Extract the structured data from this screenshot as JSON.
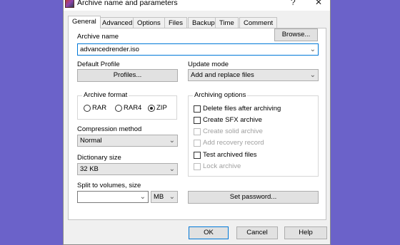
{
  "window": {
    "title": "Archive name and parameters",
    "help_glyph": "?",
    "close_glyph": "✕"
  },
  "tabs": [
    "General",
    "Advanced",
    "Options",
    "Files",
    "Backup",
    "Time",
    "Comment"
  ],
  "archive_name": {
    "label": "Archive name",
    "value": "advancedrender.iso",
    "browse_label": "Browse..."
  },
  "default_profile": {
    "label": "Default Profile",
    "button_label": "Profiles..."
  },
  "update_mode": {
    "label": "Update mode",
    "value": "Add and replace files"
  },
  "archive_format": {
    "title": "Archive format",
    "options": [
      "RAR",
      "RAR4",
      "ZIP"
    ],
    "selected": "ZIP"
  },
  "compression_method": {
    "label": "Compression method",
    "value": "Normal"
  },
  "dictionary_size": {
    "label": "Dictionary size",
    "value": "32 KB"
  },
  "split_volumes": {
    "label": "Split to volumes, size",
    "value": "",
    "unit": "MB"
  },
  "archiving_options": {
    "title": "Archiving options",
    "items": [
      {
        "label": "Delete files after archiving",
        "checked": false,
        "enabled": true
      },
      {
        "label": "Create SFX archive",
        "checked": false,
        "enabled": true
      },
      {
        "label": "Create solid archive",
        "checked": false,
        "enabled": false
      },
      {
        "label": "Add recovery record",
        "checked": false,
        "enabled": false
      },
      {
        "label": "Test archived files",
        "checked": false,
        "enabled": true
      },
      {
        "label": "Lock archive",
        "checked": false,
        "enabled": false
      }
    ]
  },
  "set_password_label": "Set password...",
  "buttons": {
    "ok": "OK",
    "cancel": "Cancel",
    "help": "Help"
  },
  "colors": {
    "background": "#6b62c9",
    "accent": "#0078d7"
  }
}
